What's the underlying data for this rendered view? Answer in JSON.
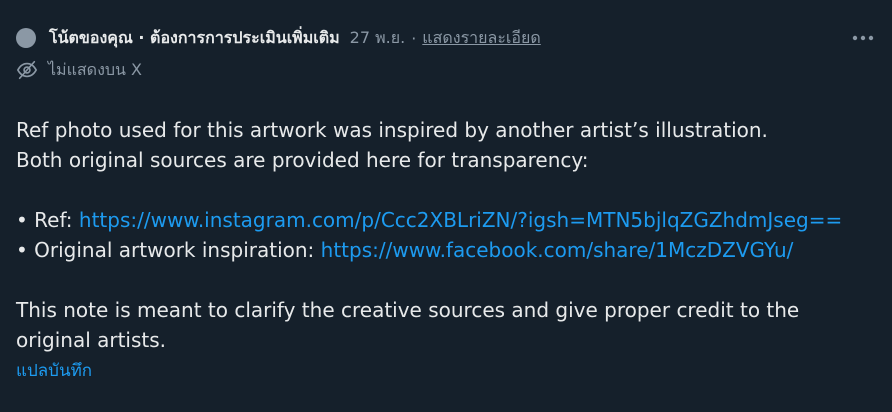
{
  "note": {
    "title": "โน้ตของคุณ · ต้องการการประเมินเพิ่มเติม",
    "date": "27 พ.ย.",
    "separator": "·",
    "details_link": "แสดงรายละเอียด",
    "visibility": "ไม่แสดงบน X",
    "more_icon": "more-horizontal-icon",
    "visibility_icon": "eye-off-icon"
  },
  "content": {
    "line1": "Ref photo used for this artwork was inspired by another artist’s illustration.",
    "line2": "Both original sources are provided here for transparency:",
    "ref_label": "• Ref: ",
    "ref_url": "https://www.instagram.com/p/Ccc2XBLriZN/?igsh=MTN5bjlqZGZhdmJseg==",
    "orig_label": "• Original artwork inspiration: ",
    "orig_url": "https://www.facebook.com/share/1MczDZVGYu/",
    "closing1": "This note is meant to clarify the creative sources and give proper credit to the",
    "closing2": "original artists."
  },
  "translate_label": "แปลบันทึก",
  "colors": {
    "background": "#15202b",
    "text": "#e7e9ea",
    "muted": "#8b98a5",
    "link": "#1d9bf0"
  }
}
